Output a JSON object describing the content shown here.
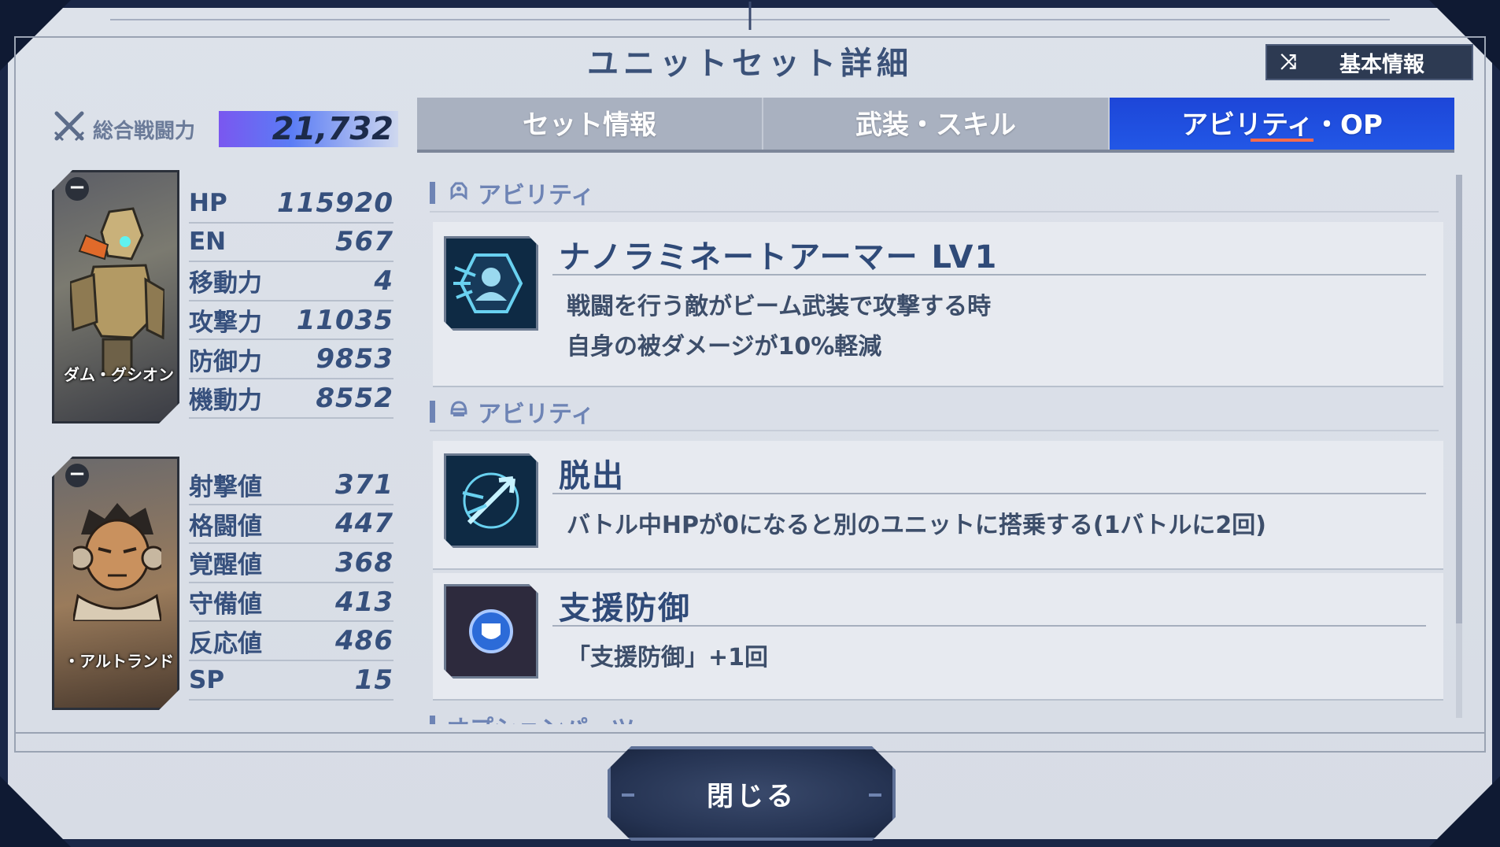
{
  "screen": {
    "title": "ユニットセット詳細",
    "basic_info_button": "基本情報"
  },
  "power": {
    "label": "総合戦闘力",
    "value": "21,732"
  },
  "mech": {
    "name": "ダム・グシオン",
    "stats": [
      {
        "label": "HP",
        "value": "115920"
      },
      {
        "label": "EN",
        "value": "567"
      },
      {
        "label": "移動力",
        "value": "4"
      },
      {
        "label": "攻撃力",
        "value": "11035"
      },
      {
        "label": "防御力",
        "value": "9853"
      },
      {
        "label": "機動力",
        "value": "8552"
      }
    ]
  },
  "pilot": {
    "name": "・アルトランド",
    "stats": [
      {
        "label": "射撃値",
        "value": "371"
      },
      {
        "label": "格闘値",
        "value": "447"
      },
      {
        "label": "覚醒値",
        "value": "368"
      },
      {
        "label": "守備値",
        "value": "413"
      },
      {
        "label": "反応値",
        "value": "486"
      },
      {
        "label": "SP",
        "value": "15"
      }
    ]
  },
  "tabs": [
    {
      "label": "セット情報",
      "active": false
    },
    {
      "label": "武装・スキル",
      "active": false
    },
    {
      "label": "アビリティ・OP",
      "active": true
    }
  ],
  "sections": {
    "unit_ability_header": "アビリティ",
    "pilot_ability_header": "アビリティ",
    "option_parts_header": "オプションパーツ"
  },
  "abilities": {
    "unit": {
      "title": "ナノラミネートアーマー LV1",
      "description": "戦闘を行う敵がビーム武装で攻撃する時\n自身の被ダメージが10%軽減"
    },
    "pilot_1": {
      "title": "脱出",
      "description": "バトル中HPが0になると別のユニットに搭乗する(1バトルに2回)"
    },
    "pilot_2": {
      "title": "支援防御",
      "description": "「支援防御」+1回"
    }
  },
  "close_button": "閉じる",
  "colors": {
    "active_tab": "#2257e6",
    "text_primary": "#36507d",
    "section_header": "#6e84b5",
    "power_bar": "#7a57f0"
  }
}
